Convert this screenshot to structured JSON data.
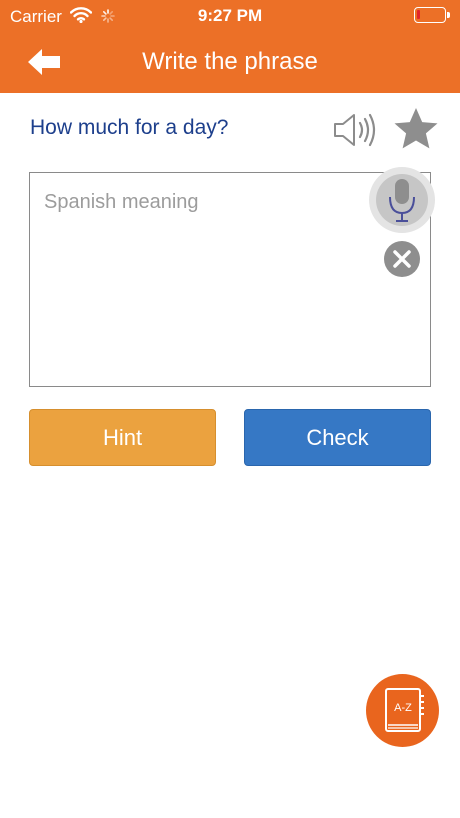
{
  "status_bar": {
    "carrier": "Carrier",
    "time": "9:27 PM",
    "battery_level": 0.1
  },
  "nav": {
    "title": "Write the phrase",
    "back_icon": "back-arrow-icon"
  },
  "phrase": {
    "text": "How much for a day?",
    "speaker_icon": "speaker-icon",
    "favorite_icon": "star-icon"
  },
  "answer": {
    "placeholder": "Spanish meaning",
    "value": "",
    "mic_icon": "microphone-icon",
    "clear_icon": "clear-icon"
  },
  "buttons": {
    "hint_label": "Hint",
    "check_label": "Check"
  },
  "dictionary": {
    "label": "A-Z",
    "icon": "dictionary-book-icon"
  },
  "colors": {
    "brand": "#ec7027",
    "phrase_text": "#1d3f8c",
    "hint_button": "#eba23f",
    "check_button": "#3678c5",
    "dictionary_fab": "#e9651e"
  }
}
